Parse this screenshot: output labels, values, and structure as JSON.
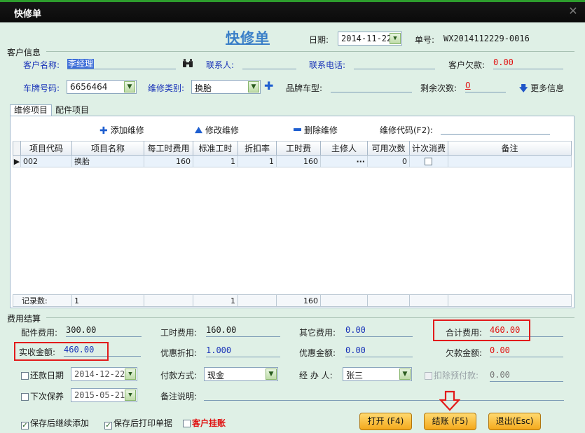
{
  "window": {
    "title": "快修单",
    "close_glyph": "✕"
  },
  "header": {
    "form_title": "快修单",
    "date_label": "日期:",
    "date_value": "2014-11-22",
    "order_no_label": "单号:",
    "order_no_value": "WX2014112229-0016"
  },
  "customer": {
    "section_label": "客户信息",
    "name_label": "客户名称:",
    "name_value": "李经理",
    "contact_label": "联系人:",
    "contact_value": "",
    "phone_label": "联系电话:",
    "phone_value": "",
    "debt_label": "客户欠款:",
    "debt_value": "0.00",
    "plate_label": "车牌号码:",
    "plate_value": "6656464",
    "repair_type_label": "维修类别:",
    "repair_type_value": "换胎",
    "brand_label": "品牌车型:",
    "brand_value": "",
    "remaining_label": "剩余次数:",
    "remaining_value": "0",
    "more_info_label": "更多信息"
  },
  "tabs": [
    {
      "label": "维修项目",
      "active": true
    },
    {
      "label": "配件项目",
      "active": false
    }
  ],
  "items_toolbar": {
    "add_label": "添加维修",
    "edit_label": "修改维修",
    "delete_label": "删除维修",
    "code_label": "维修代码(F2):"
  },
  "items_table": {
    "columns": [
      "项目代码",
      "项目名称",
      "每工时费用",
      "标准工时",
      "折扣率",
      "工时费",
      "主修人",
      "可用次数",
      "计次消费",
      "备注"
    ],
    "rows": [
      {
        "code": "002",
        "name": "换胎",
        "hour_fee": "160",
        "std_hours": "1",
        "discount": "1",
        "labor_fee": "160",
        "technician": "",
        "technician_btn": "···",
        "uses": "0",
        "count_consume": false,
        "remark": ""
      }
    ],
    "footer": {
      "label": "记录数:",
      "count": "1",
      "std_hours_total": "1",
      "labor_fee_total": "160"
    }
  },
  "settlement": {
    "section_label": "费用结算",
    "parts_fee_label": "配件费用:",
    "parts_fee_value": "300.00",
    "labor_fee_label": "工时费用:",
    "labor_fee_value": "160.00",
    "other_fee_label": "其它费用:",
    "other_fee_value": "0.00",
    "total_label": "合计费用:",
    "total_value": "460.00",
    "received_label": "实收金额:",
    "received_value": "460.00",
    "discount_label": "优惠折扣:",
    "discount_value": "1.000",
    "discount_amount_label": "优惠金额:",
    "discount_amount_value": "0.00",
    "owed_label": "欠款金额:",
    "owed_value": "0.00",
    "repay_date_label": "还款日期",
    "repay_date_value": "2014-12-22",
    "pay_method_label": "付款方式:",
    "pay_method_value": "现金",
    "handler_label": "经 办 人:",
    "handler_value": "张三",
    "deduct_label": "扣除预付款:",
    "deduct_value": "0.00",
    "next_service_label": "下次保养",
    "next_service_value": "2015-05-21",
    "remark_label": "备注说明:",
    "remark_value": ""
  },
  "options": {
    "save_continue_label": "保存后继续添加",
    "save_continue_checked": true,
    "save_print_label": "保存后打印单据",
    "save_print_checked": true,
    "hang_label": "客户挂账",
    "hang_checked": false
  },
  "buttons": {
    "open_label": "打开 (F4)",
    "checkout_label": "结账 (F5)",
    "exit_label": "退出(Esc)"
  },
  "colors": {
    "accent_blue": "#1933b8",
    "alert_red": "#e01010",
    "button_orange": "#f4a91c",
    "background": "#dff0e6"
  }
}
